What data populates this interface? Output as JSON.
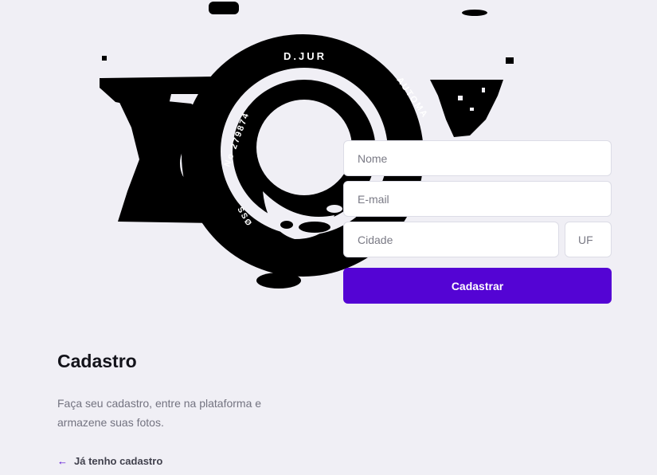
{
  "hero": {
    "lens_ring_text_top": "D.JUR",
    "lens_ring_text_right": "AUTOMA",
    "lens_ring_text_left": "No 279874",
    "lens_ring_text_bottom": "SSØ"
  },
  "form": {
    "name_placeholder": "Nome",
    "email_placeholder": "E-mail",
    "city_placeholder": "Cidade",
    "uf_placeholder": "UF",
    "submit_label": "Cadastrar"
  },
  "info": {
    "title": "Cadastro",
    "description": "Faça seu cadastro, entre na plataforma e armazene suas fotos.",
    "back_link_label": "Já tenho cadastro",
    "back_icon": "arrow-left-icon"
  },
  "colors": {
    "background": "#f0eff5",
    "accent": "#5404d4",
    "text_dark": "#13131a",
    "text_muted": "#737380"
  }
}
